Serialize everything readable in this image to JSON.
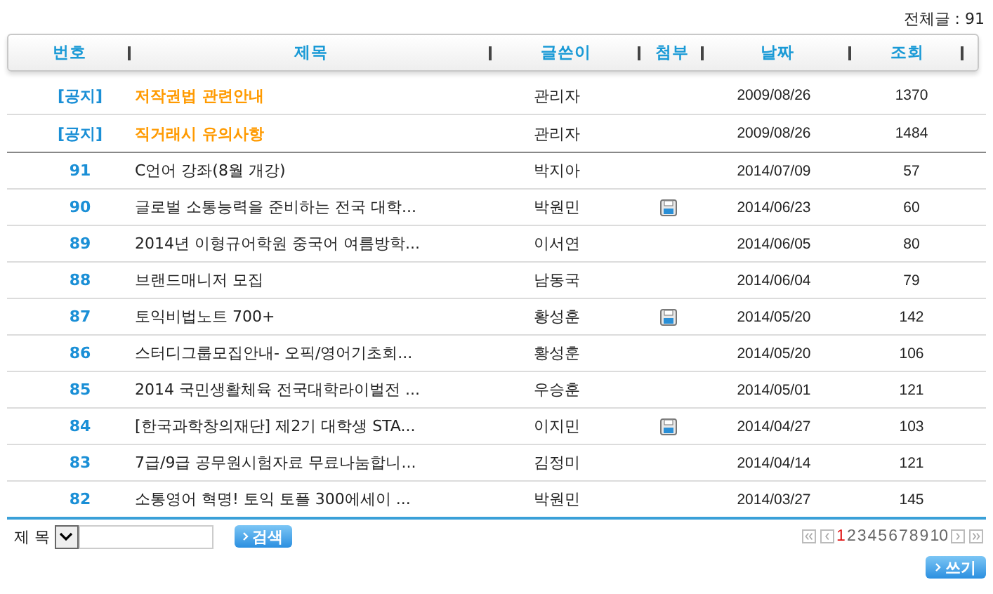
{
  "total_count": "전체글 : 91",
  "columns": [
    "번호",
    "제목",
    "글쓴이",
    "첨부",
    "날짜",
    "조회"
  ],
  "rows": [
    {
      "kind": "notice",
      "number": "[공지]",
      "title": "저작권법 관련안내",
      "author": "관리자",
      "attachment": false,
      "date": "2009/08/26",
      "views": "1370"
    },
    {
      "kind": "notice",
      "number": "[공지]",
      "title": "직거래시 유의사항",
      "author": "관리자",
      "attachment": false,
      "date": "2009/08/26",
      "views": "1484"
    },
    {
      "kind": "post",
      "number": "91",
      "title": "C언어 강좌(8월 개강)",
      "author": "박지아",
      "attachment": false,
      "date": "2014/07/09",
      "views": "57"
    },
    {
      "kind": "post",
      "number": "90",
      "title": "글로벌 소통능력을 준비하는 전국 대학...",
      "author": "박원민",
      "attachment": true,
      "date": "2014/06/23",
      "views": "60"
    },
    {
      "kind": "post",
      "number": "89",
      "title": "2014년 이형규어학원 중국어 여름방학...",
      "author": "이서연",
      "attachment": false,
      "date": "2014/06/05",
      "views": "80"
    },
    {
      "kind": "post",
      "number": "88",
      "title": "브랜드매니저 모집",
      "author": "남동국",
      "attachment": false,
      "date": "2014/06/04",
      "views": "79"
    },
    {
      "kind": "post",
      "number": "87",
      "title": "토익비법노트 700+",
      "author": "황성훈",
      "attachment": true,
      "date": "2014/05/20",
      "views": "142"
    },
    {
      "kind": "post",
      "number": "86",
      "title": "스터디그룹모집안내- 오픽/영어기초회...",
      "author": "황성훈",
      "attachment": false,
      "date": "2014/05/20",
      "views": "106"
    },
    {
      "kind": "post",
      "number": "85",
      "title": "2014 국민생활체육 전국대학라이벌전 ...",
      "author": "우승훈",
      "attachment": false,
      "date": "2014/05/01",
      "views": "121"
    },
    {
      "kind": "post",
      "number": "84",
      "title": "[한국과학창의재단] 제2기 대학생 STA...",
      "author": "이지민",
      "attachment": true,
      "date": "2014/04/27",
      "views": "103"
    },
    {
      "kind": "post",
      "number": "83",
      "title": "7급/9급 공무원시험자료 무료나눔합니...",
      "author": "김정미",
      "attachment": false,
      "date": "2014/04/14",
      "views": "121"
    },
    {
      "kind": "post",
      "number": "82",
      "title": "소통영어 혁명! 토익 토플 300에세이 ...",
      "author": "박원민",
      "attachment": false,
      "date": "2014/03/27",
      "views": "145"
    }
  ],
  "search": {
    "field_label": "제 목",
    "button": "검색"
  },
  "pages": [
    {
      "label": "1",
      "selected": true
    },
    {
      "label": "2",
      "selected": false
    },
    {
      "label": "3",
      "selected": false
    },
    {
      "label": "4",
      "selected": false
    },
    {
      "label": "5",
      "selected": false
    },
    {
      "label": "6",
      "selected": false
    },
    {
      "label": "7",
      "selected": false
    },
    {
      "label": "8",
      "selected": false
    },
    {
      "label": "9",
      "selected": false
    },
    {
      "label": "10",
      "selected": false
    }
  ],
  "write_button": "쓰기"
}
